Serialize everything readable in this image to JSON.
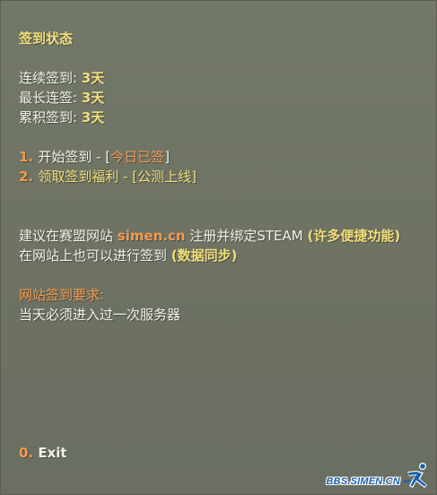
{
  "header": {
    "title": "签到状态"
  },
  "stats": [
    {
      "label": "连续签到: ",
      "value": "3天"
    },
    {
      "label": "最长连签: ",
      "value": "3天"
    },
    {
      "label": "累积签到: ",
      "value": "3天"
    }
  ],
  "options": [
    {
      "key": "1. ",
      "text": "开始签到 - [",
      "status": "今日已签",
      "end": "]"
    },
    {
      "key": "2. ",
      "text": "领取签到福利 - [公测上线]"
    }
  ],
  "advice": {
    "line1_prefix": "建议在赛盟网站 ",
    "site": "simen.cn",
    "line1_mid": " 注册并绑定STEAM ",
    "line1_extra": "(许多便捷功能)",
    "line2_prefix": "在网站上也可以进行签到 ",
    "line2_extra": "(数据同步)"
  },
  "requirement": {
    "title": "网站签到要求:",
    "text": "当天必须进入过一次服务器"
  },
  "exit": {
    "key": "0. ",
    "label": "Exit"
  },
  "logo": {
    "text": "BBS.SIMEN.CN",
    "icon": "runner-icon"
  },
  "colors": {
    "background": "#707667",
    "heading": "#f2de7a",
    "body": "#f2f2ea",
    "accent": "#f49a52",
    "logo": "#1b5fb0"
  }
}
